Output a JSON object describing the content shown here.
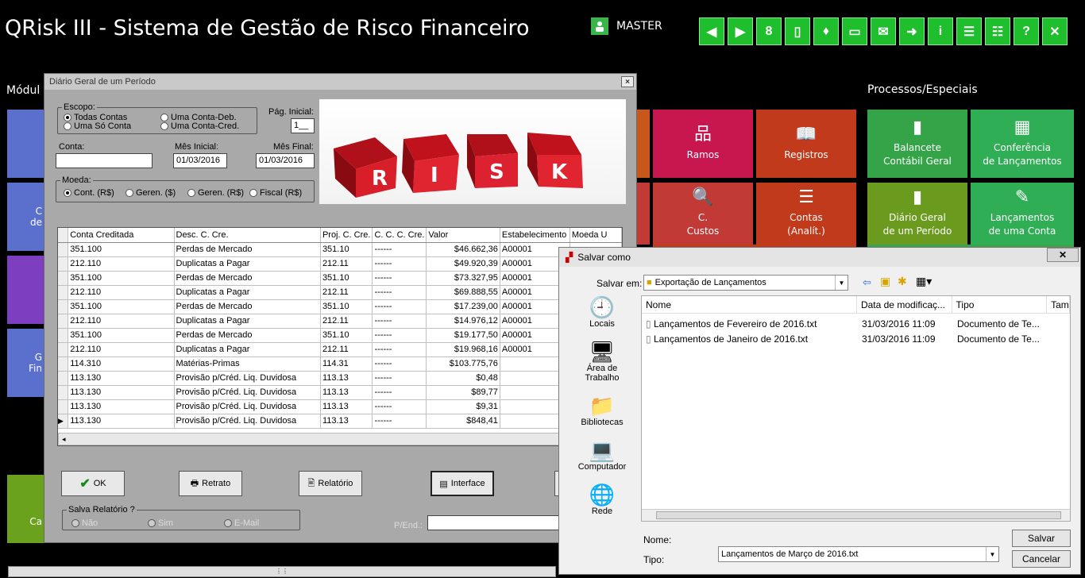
{
  "app": {
    "title": "QRisk III - Sistema de Gestão de Risco Financeiro",
    "user": "MASTER"
  },
  "toolbar": {
    "icons": [
      "prev-icon",
      "next-icon",
      "traffic-light-icon",
      "traffic-light-vertical-icon",
      "paint-bucket-icon",
      "monitor-icon",
      "mail-edit-icon",
      "mail-forward-icon",
      "info-icon",
      "document-settings-icon",
      "document-edit-icon",
      "help-icon",
      "close-icon"
    ],
    "labels": [
      "◀",
      "▶",
      "8",
      "▯",
      "♦",
      "▭",
      "✉",
      "➜",
      "i",
      "☰",
      "☷",
      "?",
      "✕"
    ]
  },
  "sections": {
    "left": "Módul",
    "right": "Processos/Especiais"
  },
  "left_tiles": [
    {
      "label": "C\nde"
    },
    {
      "label": "G\nFin"
    },
    {
      "label": "Ca"
    }
  ],
  "tiles": [
    {
      "label": "Ramos",
      "icon": "hierarchy-icon",
      "glyph": "品",
      "color": "#c8174f"
    },
    {
      "label": "Registros",
      "icon": "book-icon",
      "glyph": "📖",
      "color": "#c13a1c"
    },
    {
      "label": "Balancete\nContábil Geral",
      "icon": "ledger-icon",
      "glyph": "▮",
      "color": "#35a448"
    },
    {
      "label": "Conferência\nde Lançamentos",
      "icon": "calculator-icon",
      "glyph": "▦",
      "color": "#2fae55"
    },
    {
      "label": "C.\nCustos",
      "icon": "document-search-icon",
      "glyph": "🔍",
      "color": "#c13a35"
    },
    {
      "label": "Contas\n(Analít.)",
      "icon": "list-icon",
      "glyph": "☰",
      "color": "#c13a1c"
    },
    {
      "label": "Diário Geral\nde um Período",
      "icon": "ledger-icon",
      "glyph": "▮",
      "color": "#6a9a1e"
    },
    {
      "label": "Lançamentos\nde uma Conta",
      "icon": "edit-icon",
      "glyph": "✎",
      "color": "#2fae55"
    }
  ],
  "dialog": {
    "title": "Diário Geral de um Período",
    "escopo": {
      "label": "Escopo:",
      "options": [
        "Todas Contas",
        "Uma Só Conta",
        "Uma Conta-Deb.",
        "Uma Conta-Cred."
      ],
      "selected": 0
    },
    "pag_inicial": {
      "label": "Pág. Inicial:",
      "value": "1__"
    },
    "conta": {
      "label": "Conta:",
      "value": ""
    },
    "mes_inicial": {
      "label": "Mês Inicial:",
      "value": "01/03/2016"
    },
    "mes_final": {
      "label": "Mês Final:",
      "value": "01/03/2016"
    },
    "moeda": {
      "label": "Moeda:",
      "options": [
        "Cont. (R$)",
        "Geren. ($)",
        "Geren. (R$)",
        "Fiscal (R$)"
      ],
      "selected": 0
    },
    "banner_letters": [
      "R",
      "I",
      "S",
      "K"
    ],
    "grid": {
      "columns": [
        "Conta Creditada",
        "Desc. C. Cre.",
        "Proj. C. Cre.",
        "C. C. C. Cre.",
        "Valor",
        "Estabelecimento",
        "Moeda U"
      ],
      "rows": [
        [
          "351.100",
          "Perdas de Mercado",
          "351.10",
          "------",
          "$46.662,36",
          "A00001"
        ],
        [
          "212.110",
          "Duplicatas a Pagar",
          "212.11",
          "------",
          "$49.920,39",
          "A00001"
        ],
        [
          "351.100",
          "Perdas de Mercado",
          "351.10",
          "------",
          "$73.327,95",
          "A00001"
        ],
        [
          "212.110",
          "Duplicatas a Pagar",
          "212.11",
          "------",
          "$69.888,55",
          "A00001"
        ],
        [
          "351.100",
          "Perdas de Mercado",
          "351.10",
          "------",
          "$17.239,00",
          "A00001"
        ],
        [
          "212.110",
          "Duplicatas a Pagar",
          "212.11",
          "------",
          "$14.976,12",
          "A00001"
        ],
        [
          "351.100",
          "Perdas de Mercado",
          "351.10",
          "------",
          "$19.177,50",
          "A00001"
        ],
        [
          "212.110",
          "Duplicatas a Pagar",
          "212.11",
          "------",
          "$19.968,16",
          "A00001"
        ],
        [
          "114.310",
          "Matérias-Primas",
          "114.31",
          "------",
          "$103.775,76",
          ""
        ],
        [
          "113.130",
          "Provisão p/Créd. Liq. Duvidosa",
          "113.13",
          "------",
          "$0,48",
          ""
        ],
        [
          "113.130",
          "Provisão p/Créd. Liq. Duvidosa",
          "113.13",
          "------",
          "$89,77",
          ""
        ],
        [
          "113.130",
          "Provisão p/Créd. Liq. Duvidosa",
          "113.13",
          "------",
          "$9,31",
          ""
        ],
        [
          "113.130",
          "Provisão p/Créd. Liq. Duvidosa",
          "113.13",
          "------",
          "$848,41",
          ""
        ]
      ],
      "current_row": 12
    },
    "buttons": {
      "ok": "OK",
      "retrato": "Retrato",
      "relatorio": "Relatório",
      "interface": "Interface"
    },
    "salva": {
      "label": "Salva Relatório ?",
      "options": [
        "Não",
        "Sim",
        "E-Mail"
      ]
    },
    "pend_label": "P/End.:"
  },
  "save_dialog": {
    "title": "Salvar como",
    "salvar_em_label": "Salvar em:",
    "folder": "Exportação de Lançamentos",
    "places": [
      {
        "label": "Locais",
        "icon": "recent-places-icon",
        "glyph": "🕘"
      },
      {
        "label": "Área de\nTrabalho",
        "icon": "desktop-icon",
        "glyph": "🖥"
      },
      {
        "label": "Bibliotecas",
        "icon": "libraries-icon",
        "glyph": "📁"
      },
      {
        "label": "Computador",
        "icon": "computer-icon",
        "glyph": "💻"
      },
      {
        "label": "Rede",
        "icon": "network-icon",
        "glyph": "🌐"
      }
    ],
    "columns": [
      "Nome",
      "Data de modificaç...",
      "Tipo",
      "Tam"
    ],
    "files": [
      {
        "name": "Lançamentos de Fevereiro de 2016.txt",
        "date": "31/03/2016 11:09",
        "type": "Documento de Te..."
      },
      {
        "name": "Lançamentos de Janeiro de 2016.txt",
        "date": "31/03/2016 11:09",
        "type": "Documento de Te..."
      }
    ],
    "nome_label": "Nome:",
    "nome_value": "Lançamentos de Março de 2016.txt",
    "tipo_label": "Tipo:",
    "tipo_value": "",
    "salvar": "Salvar",
    "cancelar": "Cancelar"
  }
}
